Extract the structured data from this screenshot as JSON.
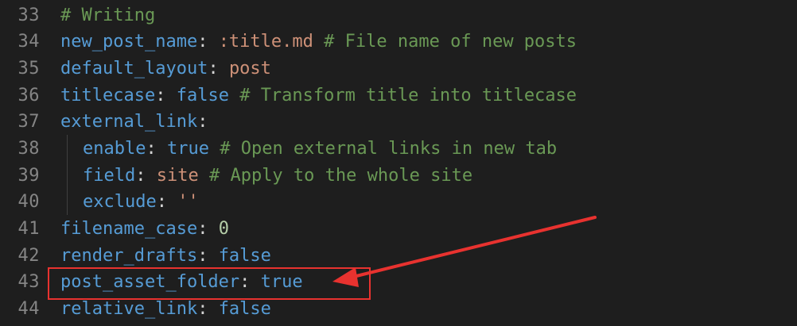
{
  "editor": {
    "lines": [
      {
        "num": "33",
        "segments": [
          {
            "t": "# Writing",
            "cls": "c"
          }
        ]
      },
      {
        "num": "34",
        "segments": [
          {
            "t": "new_post_name",
            "cls": "k"
          },
          {
            "t": ": ",
            "cls": "p"
          },
          {
            "t": ":title.md",
            "cls": "s"
          },
          {
            "t": " # File name of new posts",
            "cls": "c"
          }
        ]
      },
      {
        "num": "35",
        "segments": [
          {
            "t": "default_layout",
            "cls": "k"
          },
          {
            "t": ": ",
            "cls": "p"
          },
          {
            "t": "post",
            "cls": "s"
          }
        ]
      },
      {
        "num": "36",
        "segments": [
          {
            "t": "titlecase",
            "cls": "k"
          },
          {
            "t": ": ",
            "cls": "p"
          },
          {
            "t": "false",
            "cls": "k"
          },
          {
            "t": " # Transform title into titlecase",
            "cls": "c"
          }
        ]
      },
      {
        "num": "37",
        "segments": [
          {
            "t": "external_link",
            "cls": "k"
          },
          {
            "t": ":",
            "cls": "p"
          }
        ]
      },
      {
        "num": "38",
        "indent": true,
        "segments": [
          {
            "t": "enable",
            "cls": "k"
          },
          {
            "t": ": ",
            "cls": "p"
          },
          {
            "t": "true",
            "cls": "k"
          },
          {
            "t": " # Open external links in new tab",
            "cls": "c"
          }
        ]
      },
      {
        "num": "39",
        "indent": true,
        "segments": [
          {
            "t": "field",
            "cls": "k"
          },
          {
            "t": ": ",
            "cls": "p"
          },
          {
            "t": "site",
            "cls": "s"
          },
          {
            "t": " # Apply to the whole site",
            "cls": "c"
          }
        ]
      },
      {
        "num": "40",
        "indent": true,
        "segments": [
          {
            "t": "exclude",
            "cls": "k"
          },
          {
            "t": ": ",
            "cls": "p"
          },
          {
            "t": "''",
            "cls": "s"
          }
        ]
      },
      {
        "num": "41",
        "segments": [
          {
            "t": "filename_case",
            "cls": "k"
          },
          {
            "t": ": ",
            "cls": "p"
          },
          {
            "t": "0",
            "cls": "n"
          }
        ]
      },
      {
        "num": "42",
        "segments": [
          {
            "t": "render_drafts",
            "cls": "k"
          },
          {
            "t": ": ",
            "cls": "p"
          },
          {
            "t": "false",
            "cls": "k"
          }
        ]
      },
      {
        "num": "43",
        "segments": [
          {
            "t": "post_asset_folder",
            "cls": "k"
          },
          {
            "t": ": ",
            "cls": "p"
          },
          {
            "t": "true",
            "cls": "k"
          }
        ]
      },
      {
        "num": "44",
        "segments": [
          {
            "t": "relative_link",
            "cls": "k"
          },
          {
            "t": ": ",
            "cls": "p"
          },
          {
            "t": "false",
            "cls": "k"
          }
        ]
      }
    ]
  },
  "annotation": {
    "color": "#e8322f",
    "highlighted_line": "43"
  }
}
